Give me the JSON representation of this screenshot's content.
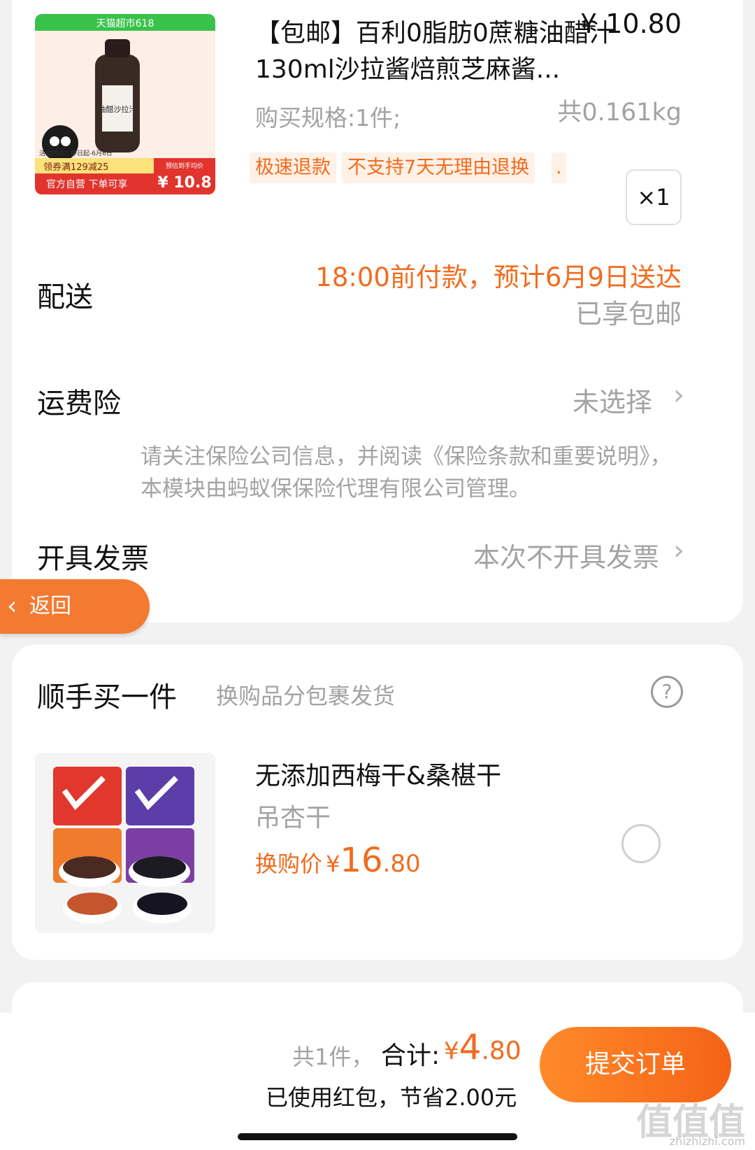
{
  "product": {
    "thumb_banner": "天猫超市618",
    "thumb_bottle_label": "油醋沙拉汁",
    "thumb_activity": "活动时间：即日起-6月6日",
    "thumb_coupon": "领券满129减25",
    "thumb_official": "官方自营 下单可享",
    "thumb_price_label": "预估到手均价",
    "thumb_price": "¥ 10.8",
    "title": "【包邮】百利0脂肪0蔗糖油醋汁130ml沙拉酱焙煎芝麻酱...",
    "price": "¥ 10.80",
    "spec": "购买规格:1件;",
    "weight": "共0.161kg",
    "tags": [
      "极速退款",
      "不支持7天无理由退换",
      "."
    ],
    "qty": "×1"
  },
  "delivery": {
    "label": "配送",
    "eta": "18:00前付款，预计6月9日送达",
    "shipping": "已享包邮"
  },
  "insurance": {
    "label": "运费险",
    "value": "未选择",
    "desc": "请关注保险公司信息，并阅读《保险条款和重要说明》，本模块由蚂蚁保保险代理有限公司管理。"
  },
  "invoice": {
    "label": "开具发票",
    "value": "本次不开具发票"
  },
  "back_button": {
    "label": "返回"
  },
  "addon": {
    "title": "顺手买一件",
    "subtitle": "换购品分包裹发货",
    "help_icon": "?",
    "name": "无添加西梅干&桑椹干",
    "sub": "吊杏干",
    "price_label": "换购价",
    "currency": "¥",
    "price_int": "16",
    "price_dec": ".80"
  },
  "footer": {
    "count": "共1件，",
    "total_label": "合计:",
    "currency": "¥",
    "total_int": "4",
    "total_dec": ".80",
    "saving": "已使用红包，节省2.00元",
    "submit": "提交订单"
  },
  "watermark": {
    "text": "值值值",
    "url": "zhizhizhi.com"
  },
  "colors": {
    "accent": "#f26b1d",
    "tag_bg": "#fff1e6",
    "back_btn": "#f47a32"
  }
}
